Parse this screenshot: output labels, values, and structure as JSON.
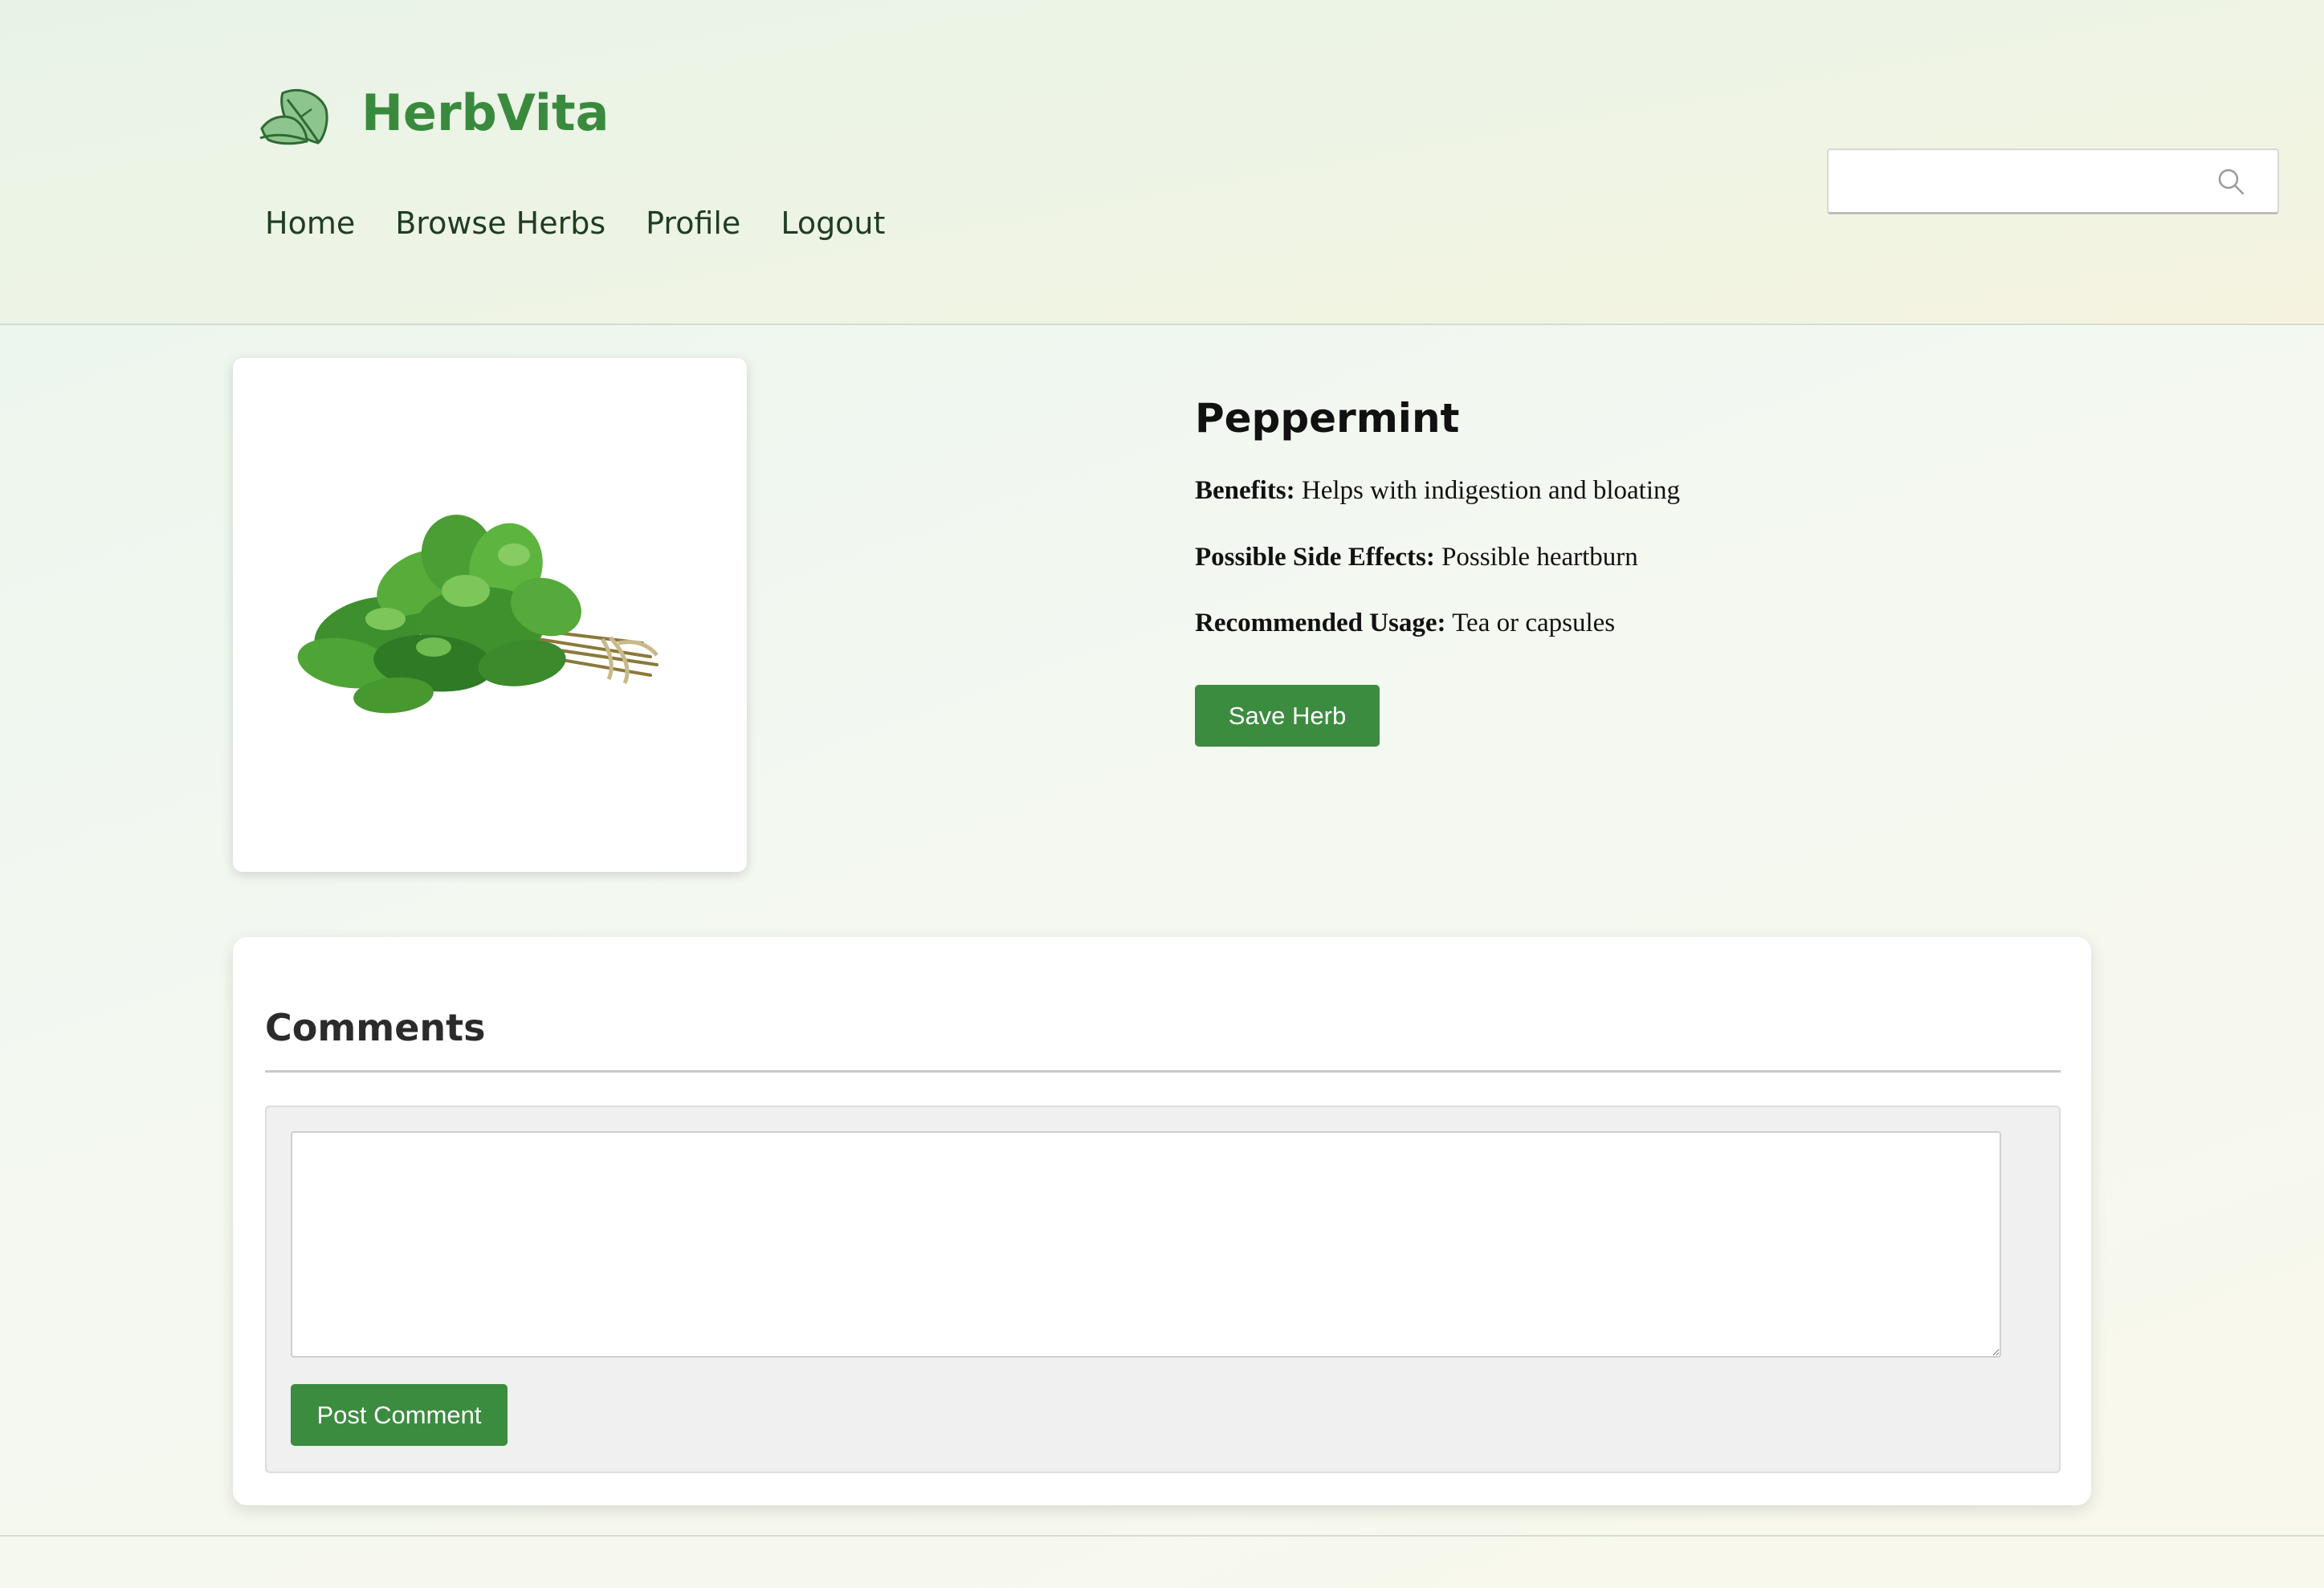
{
  "brand": {
    "name": "HerbVita",
    "logo_icon": "leaf-icon"
  },
  "nav": {
    "items": [
      {
        "label": "Home"
      },
      {
        "label": "Browse Herbs"
      },
      {
        "label": "Profile"
      },
      {
        "label": "Logout"
      }
    ]
  },
  "search": {
    "value": "",
    "placeholder": "",
    "icon": "search-icon"
  },
  "herb": {
    "name": "Peppermint",
    "image_icon": "peppermint-image",
    "benefits_label": "Benefits:",
    "benefits": "Helps with indigestion and bloating",
    "side_effects_label": "Possible Side Effects:",
    "side_effects": "Possible heartburn",
    "usage_label": "Recommended Usage:",
    "usage": "Tea or capsules",
    "save_label": "Save Herb"
  },
  "comments": {
    "title": "Comments",
    "textarea_value": "",
    "textarea_placeholder": "",
    "post_label": "Post Comment"
  },
  "colors": {
    "brand_green": "#3a8a3e",
    "button_green": "#3c8c40",
    "nav_text": "#1f3d22"
  }
}
